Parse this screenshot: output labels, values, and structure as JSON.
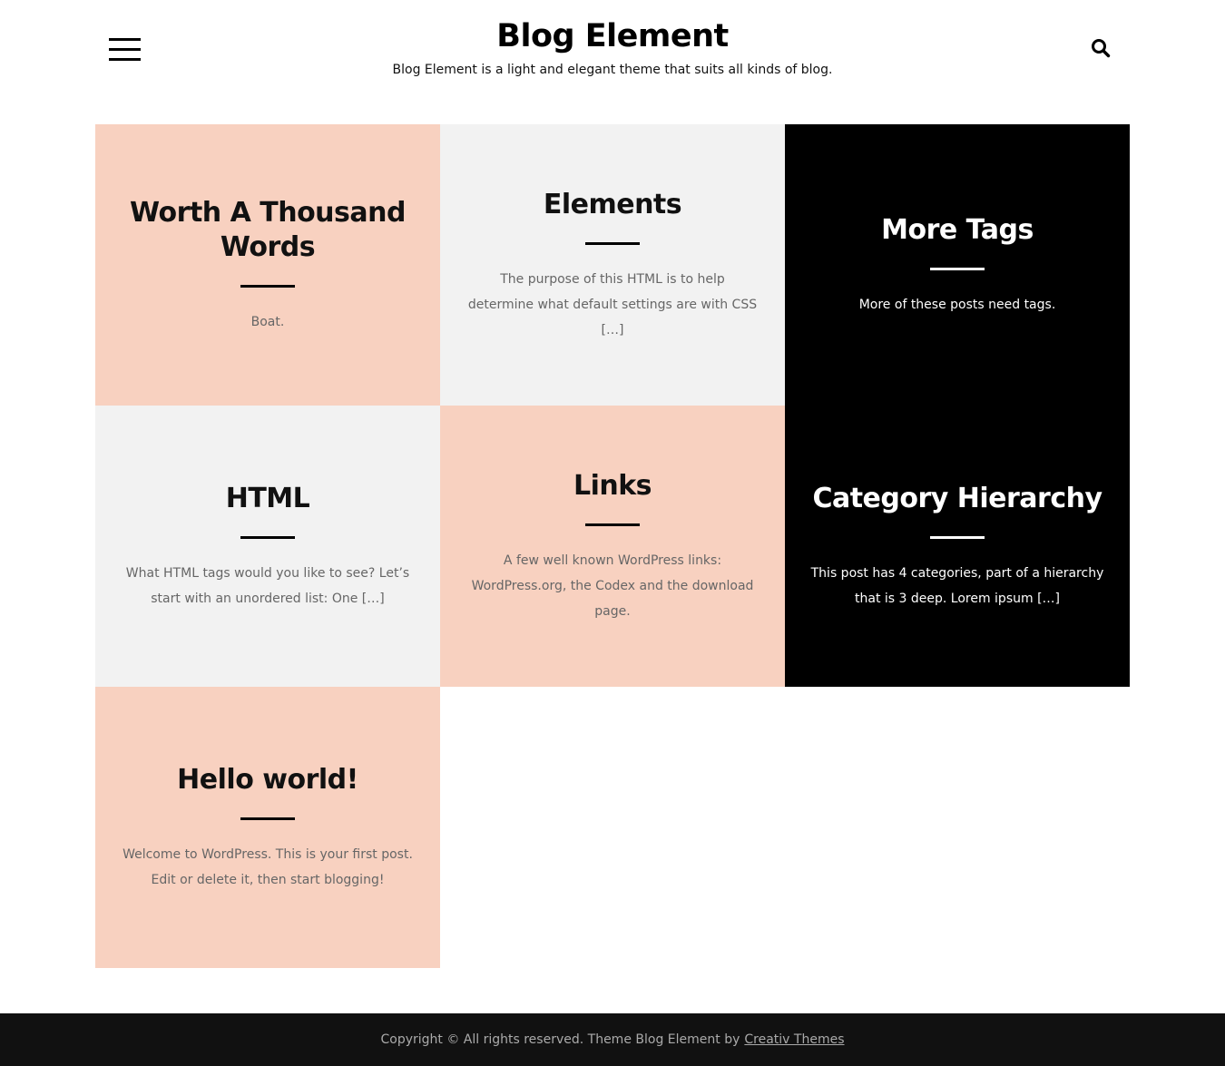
{
  "site": {
    "title": "Blog Element",
    "description": "Blog Element is a light and elegant theme that suits all kinds of blog."
  },
  "header": {
    "menu_icon": "hamburger-menu-icon",
    "search_icon": "search-icon"
  },
  "posts": [
    {
      "title": "Worth A Thousand Words",
      "excerpt": "Boat.",
      "color": "#f8d1c0"
    },
    {
      "title": "Elements",
      "excerpt": "The purpose of this HTML is to help determine what default settings are with CSS […]",
      "color": "#f2f2f2"
    },
    {
      "title": "More Tags",
      "excerpt": "More of these posts need tags.",
      "color": "#000000"
    },
    {
      "title": "HTML",
      "excerpt": "What HTML tags would you like to see? Let’s start with an unordered list: One […]",
      "color": "#f2f2f2"
    },
    {
      "title": "Links",
      "excerpt": "A few well known WordPress links: WordPress.org, the Codex and the download page.",
      "color": "#f8d1c0"
    },
    {
      "title": "Category Hierarchy",
      "excerpt": "This post has 4 categories, part of a hierarchy that is 3 deep. Lorem ipsum […]",
      "color": "#000000"
    },
    {
      "title": "Hello world!",
      "excerpt": "Welcome to WordPress. This is your first post. Edit or delete it, then start blogging!",
      "color": "#f8d1c0"
    }
  ],
  "footer": {
    "copyright": "Copyright © All rights reserved. Theme Blog Element by",
    "link_text": "Creativ Themes"
  }
}
